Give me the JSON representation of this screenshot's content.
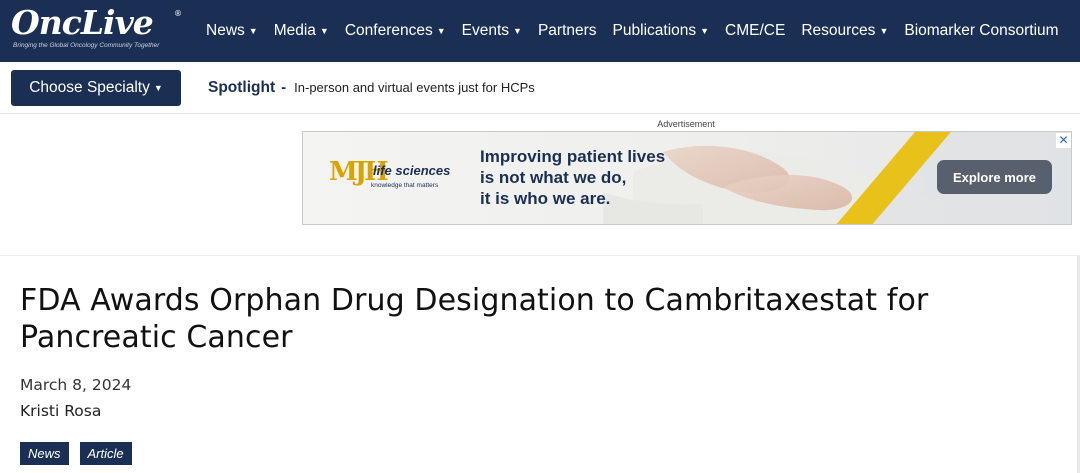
{
  "site": {
    "logo_text": "OncLive",
    "logo_registered": "®",
    "logo_tagline": "Bringing the Global Oncology Community Together"
  },
  "nav": {
    "items": [
      {
        "label": "News",
        "caret": true,
        "icon": "chevron-down-icon"
      },
      {
        "label": "Media",
        "caret": true,
        "icon": "chevron-down-icon"
      },
      {
        "label": "Conferences",
        "caret": true,
        "icon": "chevron-down-icon"
      },
      {
        "label": "Events",
        "caret": true,
        "icon": "chevron-down-icon"
      },
      {
        "label": "Partners",
        "caret": false
      },
      {
        "label": "Publications",
        "caret": true,
        "icon": "chevron-down-icon"
      },
      {
        "label": "CME/CE",
        "caret": false
      },
      {
        "label": "Resources",
        "caret": true,
        "icon": "chevron-down-icon"
      },
      {
        "label": "Biomarker Consortium",
        "caret": false
      }
    ],
    "caret_glyph": "▼"
  },
  "subbar": {
    "specialty_button": "Choose Specialty",
    "spotlight_label": "Spotlight",
    "spotlight_separator": "-",
    "spotlight_text": "In-person and virtual events just for HCPs"
  },
  "ad": {
    "label": "Advertisement",
    "brand_mark": "MJH",
    "brand_name": "life sciences",
    "brand_tagline": "knowledge that matters",
    "headline_lines": [
      "Improving patient lives",
      "is not what we do,",
      "it is who we are."
    ],
    "cta": "Explore more",
    "close_glyph": "✕",
    "accent_color": "#e8c21a"
  },
  "article": {
    "title": "FDA Awards Orphan Drug Designation to Cambritaxestat for Pancreatic Cancer",
    "date": "March 8, 2024",
    "author": "Kristi Rosa",
    "tags": [
      "News",
      "Article"
    ]
  },
  "colors": {
    "brand_navy": "#1b2f55",
    "cta_gray": "#58606e"
  }
}
